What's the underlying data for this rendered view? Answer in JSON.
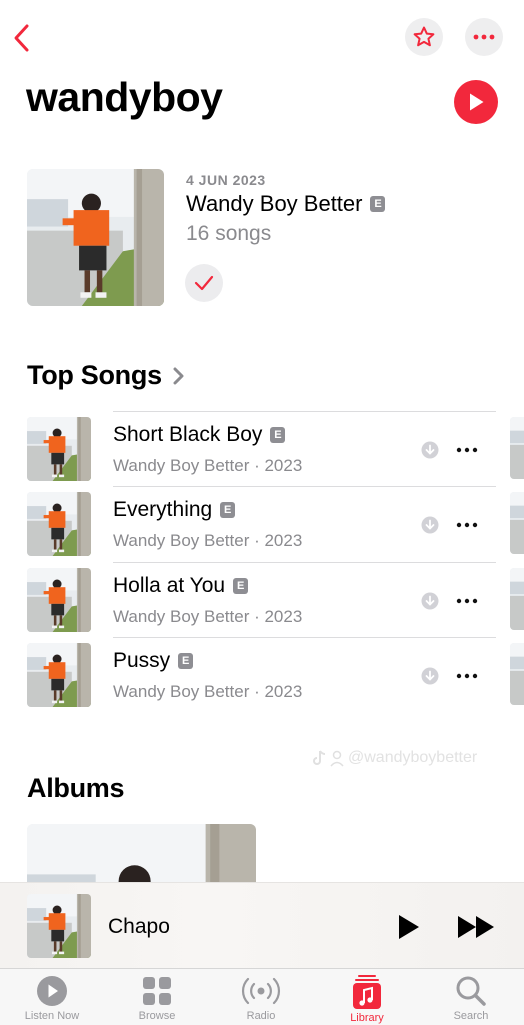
{
  "header": {
    "back_icon": "chevron-left-icon",
    "favorite_icon": "star-icon",
    "more_icon": "ellipsis-icon"
  },
  "artist": {
    "name": "wandyboy"
  },
  "latest_release": {
    "date": "4 JUN 2023",
    "title": "Wandy Boy Better",
    "explicit": "E",
    "song_count": "16 songs"
  },
  "top_songs": {
    "heading": "Top Songs",
    "items": [
      {
        "title": "Short Black Boy",
        "explicit": "E",
        "subtitle": "Wandy Boy Better · 2023"
      },
      {
        "title": "Everything",
        "explicit": "E",
        "subtitle": "Wandy Boy Better · 2023"
      },
      {
        "title": "Holla at You",
        "explicit": "E",
        "subtitle": "Wandy Boy Better · 2023"
      },
      {
        "title": "Pussy",
        "explicit": "E",
        "subtitle": "Wandy Boy Better · 2023"
      }
    ]
  },
  "watermark": "@wandyboybetter",
  "albums": {
    "heading": "Albums"
  },
  "now_playing": {
    "title": "Chapo"
  },
  "tabs": [
    {
      "label": "Listen Now"
    },
    {
      "label": "Browse"
    },
    {
      "label": "Radio"
    },
    {
      "label": "Library"
    },
    {
      "label": "Search"
    }
  ],
  "colors": {
    "accent": "#f2283c",
    "secondary_text": "#8a8a8e",
    "badge": "#8e8e93"
  }
}
